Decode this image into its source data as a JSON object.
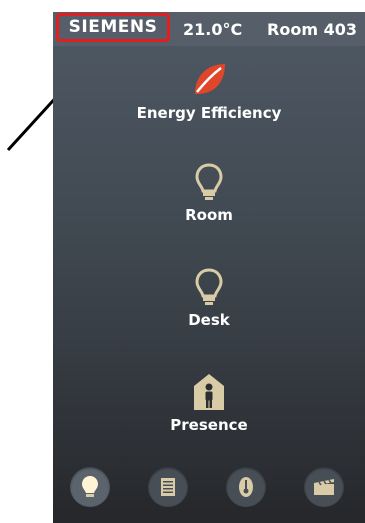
{
  "header": {
    "brand": "SIEMENS",
    "temperature": "21.0°C",
    "room": "Room 403"
  },
  "menu": [
    {
      "label": "Energy Efficiency",
      "icon": "leaf-icon"
    },
    {
      "label": "Room",
      "icon": "bulb-icon"
    },
    {
      "label": "Desk",
      "icon": "bulb-icon"
    },
    {
      "label": "Presence",
      "icon": "person-icon"
    }
  ],
  "bottom_nav": [
    {
      "icon": "lightbulb-icon",
      "active": true
    },
    {
      "icon": "blinds-icon",
      "active": false
    },
    {
      "icon": "thermometer-icon",
      "active": false
    },
    {
      "icon": "scene-clapper-icon",
      "active": false
    }
  ],
  "colors": {
    "accent_red": "#e02020",
    "icon_beige": "#d8cba6",
    "leaf_orange": "#e0462a"
  }
}
